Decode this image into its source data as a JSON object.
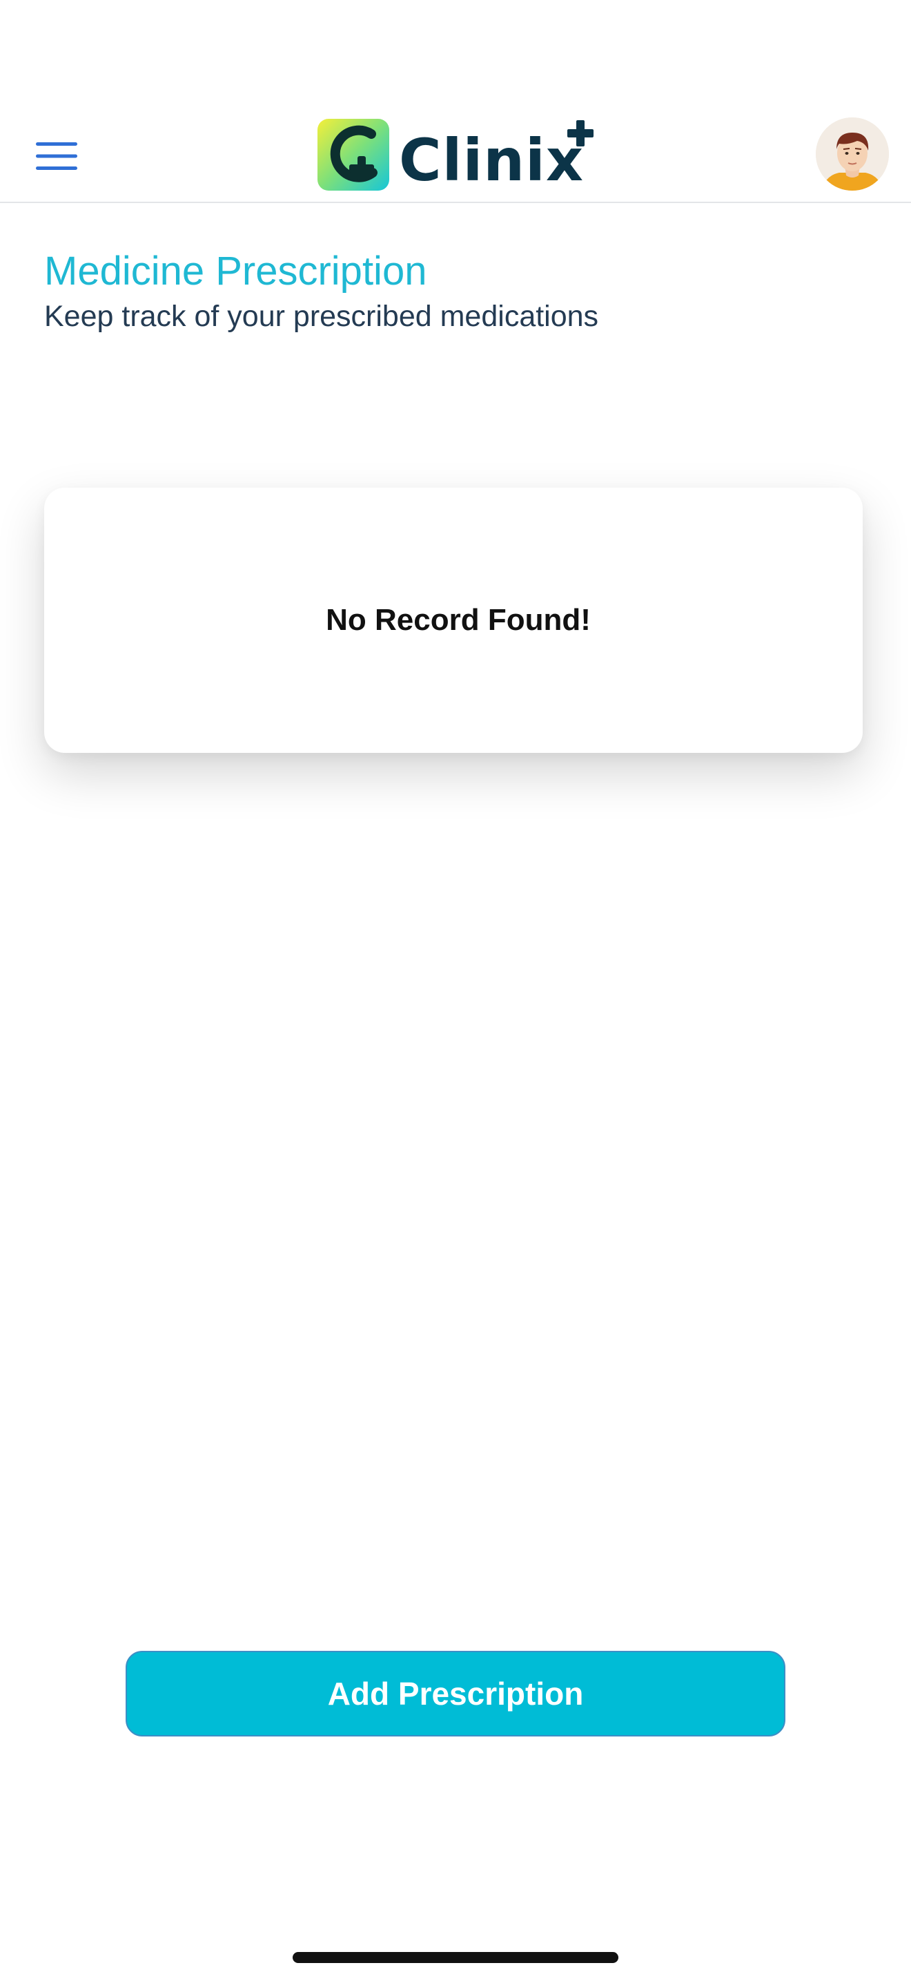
{
  "header": {
    "brand_name": "Clinix",
    "menu_icon": "hamburger-menu-icon",
    "avatar_icon": "user-avatar",
    "accent_color": "#1fb8d3"
  },
  "page": {
    "title": "Medicine Prescription",
    "subtitle": "Keep track of your prescribed medications"
  },
  "records": {
    "empty_message": "No Record Found!"
  },
  "actions": {
    "add_label": "Add Prescription",
    "button_color": "#00bcd6"
  }
}
